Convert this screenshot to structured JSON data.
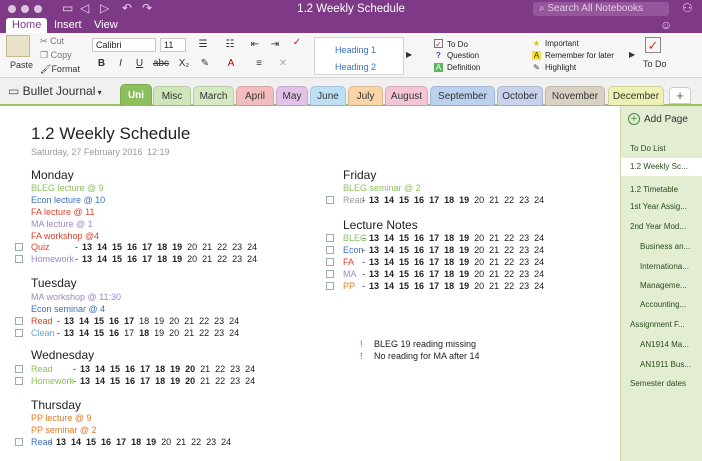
{
  "window": {
    "title": "1.2 Weekly Schedule",
    "search_placeholder": "Search All Notebooks"
  },
  "ribbon_tabs": [
    "Home",
    "Insert",
    "View"
  ],
  "clipboard": {
    "paste": "Paste",
    "cut": "Cut",
    "copy": "Copy",
    "format": "Format"
  },
  "font": {
    "name": "Calibri",
    "size": "11"
  },
  "styles": [
    "Heading 1",
    "Heading 2"
  ],
  "tags": [
    "To Do",
    "Question",
    "Definition",
    "Important",
    "Remember for later",
    "Highlight"
  ],
  "todo_label": "To Do",
  "notebook": "Bullet Journal",
  "sections": [
    {
      "label": "Uni",
      "color": "#8cc05d"
    },
    {
      "label": "Misc",
      "color": "#cfe6ba"
    },
    {
      "label": "March",
      "color": "#d5e9c2"
    },
    {
      "label": "April",
      "color": "#f4bdbd"
    },
    {
      "label": "May",
      "color": "#e3c2e9"
    },
    {
      "label": "June",
      "color": "#bde0f4"
    },
    {
      "label": "July",
      "color": "#f9d4a7"
    },
    {
      "label": "August",
      "color": "#f4c5d4"
    },
    {
      "label": "September",
      "color": "#bcd1ef"
    },
    {
      "label": "October",
      "color": "#c8d2ec"
    },
    {
      "label": "November",
      "color": "#d9d2c4"
    },
    {
      "label": "December",
      "color": "#eef1b3"
    }
  ],
  "pages": {
    "add": "Add Page",
    "items": [
      "To Do List",
      "1.2 Weekly Sc...",
      "1.2 Timetable",
      "1st Year Assig...",
      "2nd Year Mod...",
      "Business an...",
      "Internationa...",
      "Manageme...",
      "Accounting...",
      "Assignment F...",
      "AN1914 Ma...",
      "AN1911 Bus...",
      "Semester dates"
    ]
  },
  "note": {
    "title": "1.2 Weekly Schedule",
    "date": "Saturday, 27 February 2016",
    "time": "12:19",
    "days": {
      "monday": "Monday",
      "tuesday": "Tuesday",
      "wednesday": "Wednesday",
      "thursday": "Thursday",
      "friday": "Friday"
    },
    "lecture_notes": "Lecture Notes",
    "monday": [
      "BLEG lecture @ 9",
      "Econ lecture @ 10",
      "FA lecture @ 11",
      "MA lecture @ 1",
      "FA workshop @4"
    ],
    "monday_tasks": [
      "Quiz",
      "Homework"
    ],
    "tuesday": [
      "MA workshop @ 11:30",
      "Econ seminar @ 4"
    ],
    "tuesday_tasks": [
      "Read",
      "Clean"
    ],
    "wednesday_tasks": [
      "Read",
      "Homework"
    ],
    "thursday": [
      "PP lecture @ 9",
      "PP seminar @ 2"
    ],
    "thursday_task": "Read",
    "friday": [
      "BLEG seminar @ 2"
    ],
    "friday_task": "Read",
    "lecture_rows": [
      "BLEG",
      "Econ",
      "FA",
      "MA",
      "PP"
    ],
    "notes": [
      "BLEG 19 reading missing",
      "No reading for MA after 14"
    ],
    "excl": "!",
    "sep": "-",
    "num": [
      "13",
      "14",
      "15",
      "16",
      "17",
      "18",
      "19",
      "20",
      "21",
      "22",
      "23",
      "24"
    ]
  }
}
